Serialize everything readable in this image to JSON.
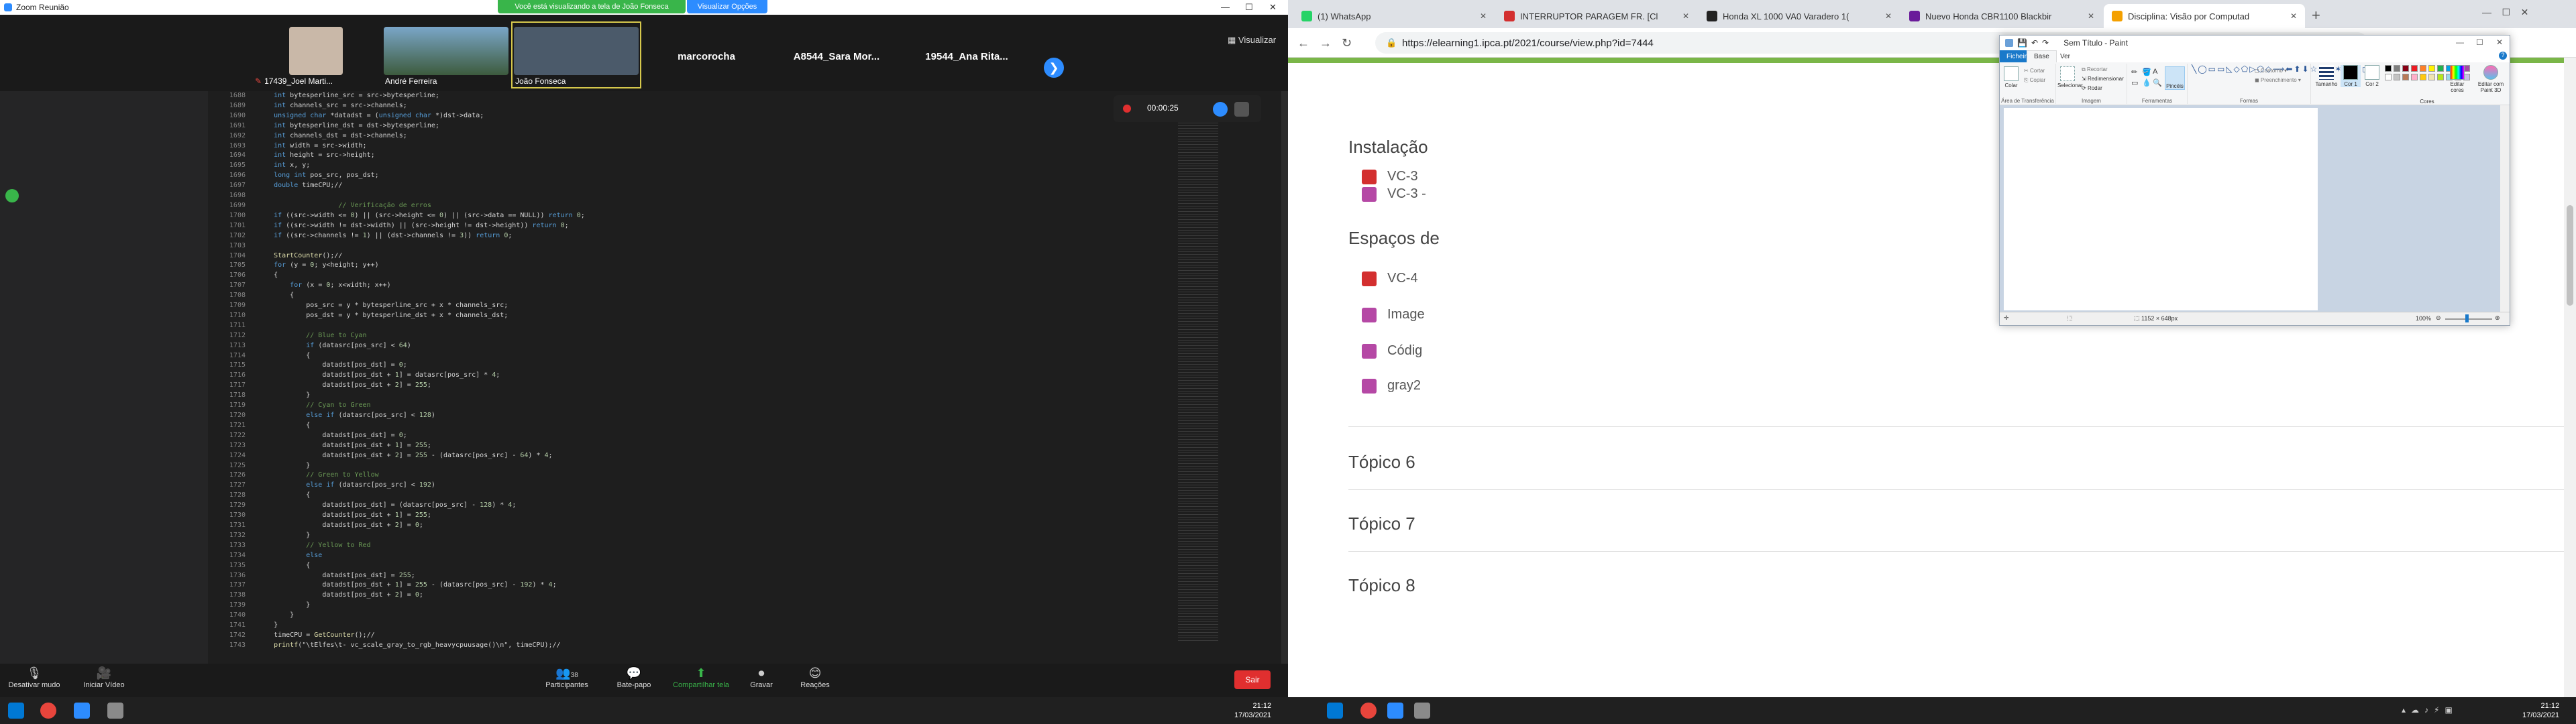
{
  "zoom": {
    "title": "Zoom Reunião",
    "share_banner": "Você está visualizando a tela de João Fonseca",
    "view_options": "Visualizar Opções",
    "view_button": "Visualizar",
    "gallery_next": "❯",
    "participants": [
      {
        "name": "17439_Joel Marti...",
        "type": "video"
      },
      {
        "name": "André Ferreira",
        "type": "video"
      },
      {
        "name": "João Fonseca",
        "type": "video"
      },
      {
        "name": "marcorocha",
        "type": "text"
      },
      {
        "name": "A8544_Sara Mor...",
        "type": "text"
      },
      {
        "name": "19544_Ana Rita...",
        "type": "text"
      }
    ],
    "record_time": "00:00:25",
    "toolbar": [
      {
        "label": "Desativar mudo",
        "icon": "🎙"
      },
      {
        "label": "Iniciar Vídeo",
        "icon": "🎥"
      },
      {
        "label": "Participantes",
        "icon": "👥",
        "badge": "38"
      },
      {
        "label": "Bate-papo",
        "icon": "💬"
      },
      {
        "label": "Compartilhar tela",
        "icon": "⬆"
      },
      {
        "label": "Gravar",
        "icon": "⏺"
      },
      {
        "label": "Reações",
        "icon": "😊"
      }
    ],
    "leave": "Sair"
  },
  "code": {
    "lines": [
      {
        "n": "1688",
        "t": "    int bytesperline_src = src->bytesperline;"
      },
      {
        "n": "1689",
        "t": "    int channels_src = src->channels;"
      },
      {
        "n": "1690",
        "t": "    unsigned char *datadst = (unsigned char *)dst->data;"
      },
      {
        "n": "1691",
        "t": "    int bytesperline_dst = dst->bytesperline;"
      },
      {
        "n": "1692",
        "t": "    int channels_dst = dst->channels;"
      },
      {
        "n": "1693",
        "t": "    int width = src->width;"
      },
      {
        "n": "1694",
        "t": "    int height = src->height;"
      },
      {
        "n": "1695",
        "t": "    int x, y;"
      },
      {
        "n": "1696",
        "t": "    long int pos_src, pos_dst;"
      },
      {
        "n": "1697",
        "t": "    double timeCPU;//"
      },
      {
        "n": "1698",
        "t": ""
      },
      {
        "n": "1699",
        "t": "                    // Verificação de erros"
      },
      {
        "n": "1700",
        "t": "    if ((src->width <= 0) || (src->height <= 0) || (src->data == NULL)) return 0;"
      },
      {
        "n": "1701",
        "t": "    if ((src->width != dst->width) || (src->height != dst->height)) return 0;"
      },
      {
        "n": "1702",
        "t": "    if ((src->channels != 1) || (dst->channels != 3)) return 0;"
      },
      {
        "n": "1703",
        "t": ""
      },
      {
        "n": "1704",
        "t": "    StartCounter();//"
      },
      {
        "n": "1705",
        "t": "    for (y = 0; y<height; y++)"
      },
      {
        "n": "1706",
        "t": "    {"
      },
      {
        "n": "1707",
        "t": "        for (x = 0; x<width; x++)"
      },
      {
        "n": "1708",
        "t": "        {"
      },
      {
        "n": "1709",
        "t": "            pos_src = y * bytesperline_src + x * channels_src;"
      },
      {
        "n": "1710",
        "t": "            pos_dst = y * bytesperline_dst + x * channels_dst;"
      },
      {
        "n": "1711",
        "t": ""
      },
      {
        "n": "1712",
        "t": "            // Blue to Cyan"
      },
      {
        "n": "1713",
        "t": "            if (datasrc[pos_src] < 64)"
      },
      {
        "n": "1714",
        "t": "            {"
      },
      {
        "n": "1715",
        "t": "                datadst[pos_dst] = 0;"
      },
      {
        "n": "1716",
        "t": "                datadst[pos_dst + 1] = datasrc[pos_src] * 4;"
      },
      {
        "n": "1717",
        "t": "                datadst[pos_dst + 2] = 255;"
      },
      {
        "n": "1718",
        "t": "            }"
      },
      {
        "n": "1719",
        "t": "            // Cyan to Green"
      },
      {
        "n": "1720",
        "t": "            else if (datasrc[pos_src] < 128)"
      },
      {
        "n": "1721",
        "t": "            {"
      },
      {
        "n": "1722",
        "t": "                datadst[pos_dst] = 0;"
      },
      {
        "n": "1723",
        "t": "                datadst[pos_dst + 1] = 255;"
      },
      {
        "n": "1724",
        "t": "                datadst[pos_dst + 2] = 255 - (datasrc[pos_src] - 64) * 4;"
      },
      {
        "n": "1725",
        "t": "            }"
      },
      {
        "n": "1726",
        "t": "            // Green to Yellow"
      },
      {
        "n": "1727",
        "t": "            else if (datasrc[pos_src] < 192)"
      },
      {
        "n": "1728",
        "t": "            {"
      },
      {
        "n": "1729",
        "t": "                datadst[pos_dst] = (datasrc[pos_src] - 128) * 4;"
      },
      {
        "n": "1730",
        "t": "                datadst[pos_dst + 1] = 255;"
      },
      {
        "n": "1731",
        "t": "                datadst[pos_dst + 2] = 0;"
      },
      {
        "n": "1732",
        "t": "            }"
      },
      {
        "n": "1733",
        "t": "            // Yellow to Red"
      },
      {
        "n": "1734",
        "t": "            else"
      },
      {
        "n": "1735",
        "t": "            {"
      },
      {
        "n": "1736",
        "t": "                datadst[pos_dst] = 255;"
      },
      {
        "n": "1737",
        "t": "                datadst[pos_dst + 1] = 255 - (datasrc[pos_src] - 192) * 4;"
      },
      {
        "n": "1738",
        "t": "                datadst[pos_dst + 2] = 0;"
      },
      {
        "n": "1739",
        "t": "            }"
      },
      {
        "n": "1740",
        "t": "        }"
      },
      {
        "n": "1741",
        "t": "    }"
      },
      {
        "n": "1742",
        "t": "    timeCPU = GetCounter();//"
      },
      {
        "n": "1743",
        "t": "    printf(\"\\tElfes\\t- vc_scale_gray_to_rgb_heavycpuusage()\\n\", timeCPU);//"
      }
    ]
  },
  "chrome": {
    "tabs": [
      {
        "title": "(1) WhatsApp",
        "color": "#25d366"
      },
      {
        "title": "INTERRUPTOR PARAGEM FR. [Cl",
        "color": "#d32f2f"
      },
      {
        "title": "Honda XL 1000 VA0 Varadero 1(",
        "color": "#222222"
      },
      {
        "title": "Nuevo Honda CBR1100 Blackbir",
        "color": "#6a1b9a"
      },
      {
        "title": "Disciplina: Visão por Computad",
        "color": "#f4a000"
      }
    ],
    "new_tab": "+",
    "url": "https://elearning1.ipca.pt/2021/course/view.php?id=7444",
    "moodle": {
      "sections": [
        {
          "title": "Instalação"
        },
        {
          "title": "Espaços de"
        },
        {
          "title": "Tópico 6"
        },
        {
          "title": "Tópico 7"
        },
        {
          "title": "Tópico 8"
        }
      ],
      "items_install": [
        {
          "label": "VC-3",
          "kind": "pdf"
        },
        {
          "label": "VC-3 -",
          "kind": "doc"
        }
      ],
      "items_spaces": [
        {
          "label": "VC-4",
          "kind": "pdf"
        },
        {
          "label": "Image",
          "kind": "doc"
        },
        {
          "label": "Códig",
          "kind": "doc"
        },
        {
          "label": "gray2",
          "kind": "doc"
        }
      ]
    }
  },
  "paint": {
    "title": "Sem Título - Paint",
    "tabs": [
      "Ficheiro",
      "Base",
      "Ver"
    ],
    "groups": [
      "Área de Transferência",
      "Imagem",
      "Ferramentas",
      "Formas",
      "Cores"
    ],
    "clipboard": {
      "paste": "Colar",
      "cut": "Cortar",
      "copy": "Copiar"
    },
    "image": {
      "select": "Selecionar",
      "crop": "Recortar",
      "resize": "Redimensionar",
      "rotate": "Rodar"
    },
    "tools": {
      "brushes": "Pincéis"
    },
    "shapes": {
      "outline": "Contorno",
      "fill": "Preenchimento"
    },
    "size": "Tamanho",
    "color1": "Cor 1",
    "color2": "Cor 2",
    "edit_colors": "Editar cores",
    "edit_3d": "Editar com Paint 3D",
    "palette": [
      "#000000",
      "#7f7f7f",
      "#880015",
      "#ed1c24",
      "#ff7f27",
      "#fff200",
      "#22b14c",
      "#00a2e8",
      "#3f48cc",
      "#a349a4",
      "#ffffff",
      "#c3c3c3",
      "#b97a57",
      "#ffaec9",
      "#ffc90e",
      "#efe4b0",
      "#b5e61d",
      "#99d9ea",
      "#7092be",
      "#c8bfe7"
    ],
    "dimensions": "1152 × 648px",
    "zoom": "100%"
  },
  "taskbar": {
    "left_time": "21:12",
    "left_date": "17/03/2021",
    "right_time": "21:12",
    "right_date": "17/03/2021"
  }
}
